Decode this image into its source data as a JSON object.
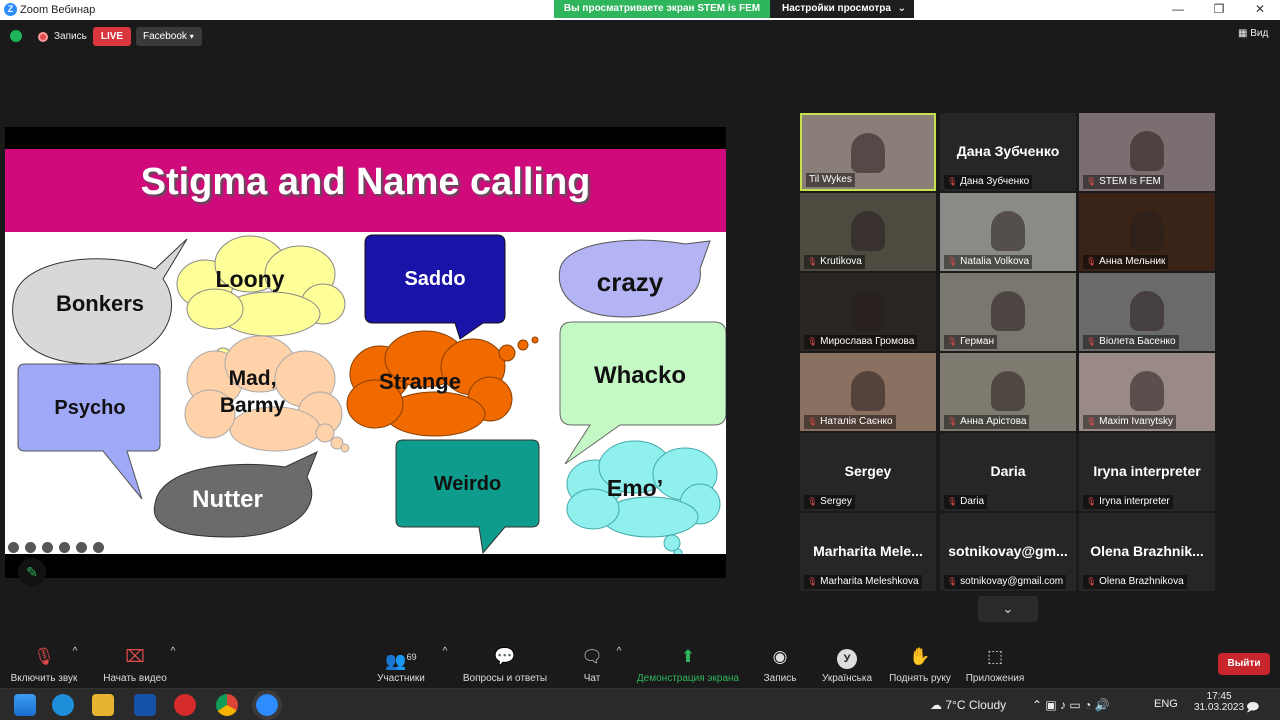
{
  "window": {
    "title": "Zoom Вебинар",
    "logo": "Z"
  },
  "share_banner": {
    "text": "Вы просматриваете экран STEM is FEM",
    "view_options": "Настройки просмотра"
  },
  "topbar": {
    "recording": "Запись",
    "live": "LIVE",
    "stream_target": "Facebook",
    "view": "Вид"
  },
  "slide": {
    "title": "Stigma and Name calling",
    "words": {
      "bonkers": "Bonkers",
      "loony": "Loony",
      "saddo": "Saddo",
      "crazy": "crazy",
      "psycho": "Psycho",
      "mad": "Mad,\nBarmy",
      "strange": "Strange",
      "whacko": "Whacko",
      "nutter": "Nutter",
      "weirdo": "Weirdo",
      "emo": "Emo’"
    },
    "colors": {
      "banner": "#d10a7c",
      "bonkers": "#d8d8d8",
      "loony": "#ffff99",
      "saddo": "#1a13a8",
      "crazy": "#b4b4f4",
      "psycho": "#a0a8f8",
      "mad": "#ffd2aa",
      "strange": "#f06a00",
      "whacko": "#c4f8c4",
      "nutter": "#6b6b6b",
      "weirdo": "#0e9c8c",
      "emo": "#8ff0ee"
    }
  },
  "participants": [
    {
      "name": "Til Wykes",
      "video": true,
      "active": true
    },
    {
      "name": "Дана Зубченко",
      "video": false
    },
    {
      "name": "STEM is FEM",
      "video": true
    },
    {
      "name": "Krutikova",
      "video": true
    },
    {
      "name": "Natalia Volkova",
      "video": true
    },
    {
      "name": "Анна Мельник",
      "video": true
    },
    {
      "name": "Мирослава Громова",
      "video": true
    },
    {
      "name": "Герман",
      "video": true
    },
    {
      "name": "Віолета Басенко",
      "video": true
    },
    {
      "name": "Наталія Саєнко",
      "video": true
    },
    {
      "name": "Анна Арістова",
      "video": true
    },
    {
      "name": "Maxim Ivanytsky",
      "video": true
    },
    {
      "name": "Sergey",
      "video": false
    },
    {
      "name": "Daria",
      "video": false
    },
    {
      "name": "Iryna interpreter",
      "video": false
    },
    {
      "name": "Marharita Meleshkova",
      "big": "Marharita  Mele...",
      "video": false
    },
    {
      "name": "sotnikovay@gmail.com",
      "big": "sotnikovay@gm...",
      "video": false
    },
    {
      "name": "Olena Brazhnikova",
      "big": "Olena  Brazhnik...",
      "video": false
    }
  ],
  "toolbar": {
    "unmute": "Включить звук",
    "start_video": "Начать видео",
    "participants": "Участники",
    "participants_count": "69",
    "qa": "Вопросы и ответы",
    "chat": "Чат",
    "share": "Демонстрация экрана",
    "record": "Запись",
    "language": "Українська",
    "language_badge": "У",
    "raise_hand": "Поднять руку",
    "apps": "Приложения",
    "leave": "Выйти"
  },
  "taskbar": {
    "weather": "7°C  Cloudy",
    "lang": "ENG",
    "time": "17:45",
    "date": "31.03.2023"
  }
}
